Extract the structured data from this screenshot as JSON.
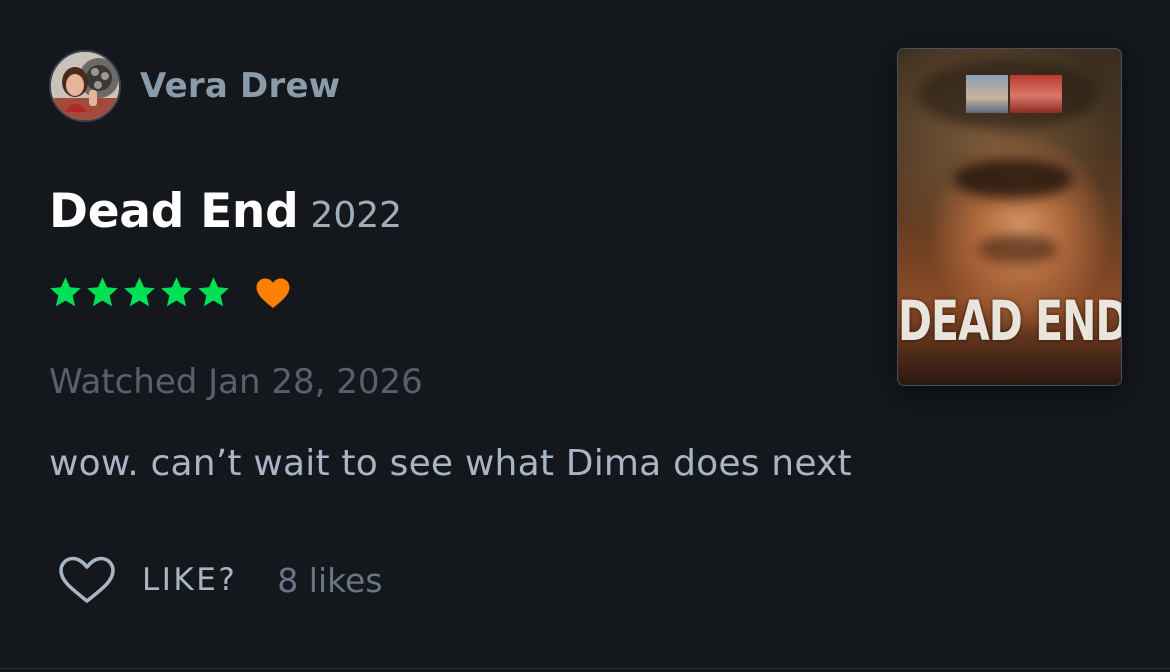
{
  "author": {
    "name": "Vera Drew",
    "avatar_icon": "profile-photo"
  },
  "film": {
    "title": "Dead End",
    "year": "2022",
    "poster_title": "DEAD END"
  },
  "rating": {
    "stars": 5,
    "max_stars": 5,
    "star_color": "#00e054",
    "liked": true,
    "heart_color": "#ff8000"
  },
  "watched": "Watched Jan 28, 2026",
  "review_text": "wow. can’t wait to see what Dima does next",
  "actions": {
    "like_label": "LIKE?",
    "like_count": "8 likes"
  }
}
